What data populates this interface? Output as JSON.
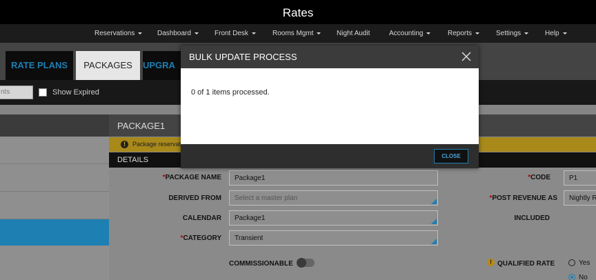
{
  "header": {
    "title": "Rates"
  },
  "nav": {
    "items": [
      {
        "label": "Reservations",
        "dropdown": true
      },
      {
        "label": "Dashboard",
        "dropdown": true
      },
      {
        "label": "Front Desk",
        "dropdown": true
      },
      {
        "label": "Rooms Mgmt",
        "dropdown": true
      },
      {
        "label": "Night Audit",
        "dropdown": false
      },
      {
        "label": "Accounting",
        "dropdown": true
      },
      {
        "label": "Reports",
        "dropdown": true
      },
      {
        "label": "Settings",
        "dropdown": true
      },
      {
        "label": "Help",
        "dropdown": true
      }
    ]
  },
  "tabs": [
    {
      "label": "RATE PLANS",
      "active": false
    },
    {
      "label": "PACKAGES",
      "active": true
    },
    {
      "label": "UPGRA",
      "active": false
    }
  ],
  "filter": {
    "search_value": "nts",
    "show_expired_label": "Show Expired",
    "show_expired_checked": false
  },
  "package": {
    "title": "PACKAGE1",
    "warning_text": "Package reservat",
    "details_label": "DETAILS",
    "fields": {
      "package_name": {
        "label": "PACKAGE NAME",
        "required": "*",
        "value": "Package1"
      },
      "derived_from": {
        "label": "DERIVED FROM",
        "placeholder": "Select a master plan"
      },
      "calendar": {
        "label": "CALENDAR",
        "value": "Package1"
      },
      "category": {
        "label": "CATEGORY",
        "required": "*",
        "value": "Transient"
      },
      "commissionable": {
        "label": "COMMISSIONABLE",
        "on": false
      },
      "code": {
        "label": "CODE",
        "required": "*",
        "value": "P1"
      },
      "post_revenue_as": {
        "label": "POST REVENUE AS",
        "required": "*",
        "value": "Nightly R"
      },
      "included": {
        "label": "INCLUDED"
      },
      "qualified_rate": {
        "label": "QUALIFIED RATE",
        "options": [
          "Yes",
          "No"
        ],
        "selected": "No"
      }
    }
  },
  "modal": {
    "title": "BULK UPDATE PROCESS",
    "message": "0 of 1 items processed.",
    "close_button": "CLOSE"
  },
  "colors": {
    "accent_blue": "#1e7fb3",
    "warning": "#a8891a",
    "required": "#b30000"
  }
}
